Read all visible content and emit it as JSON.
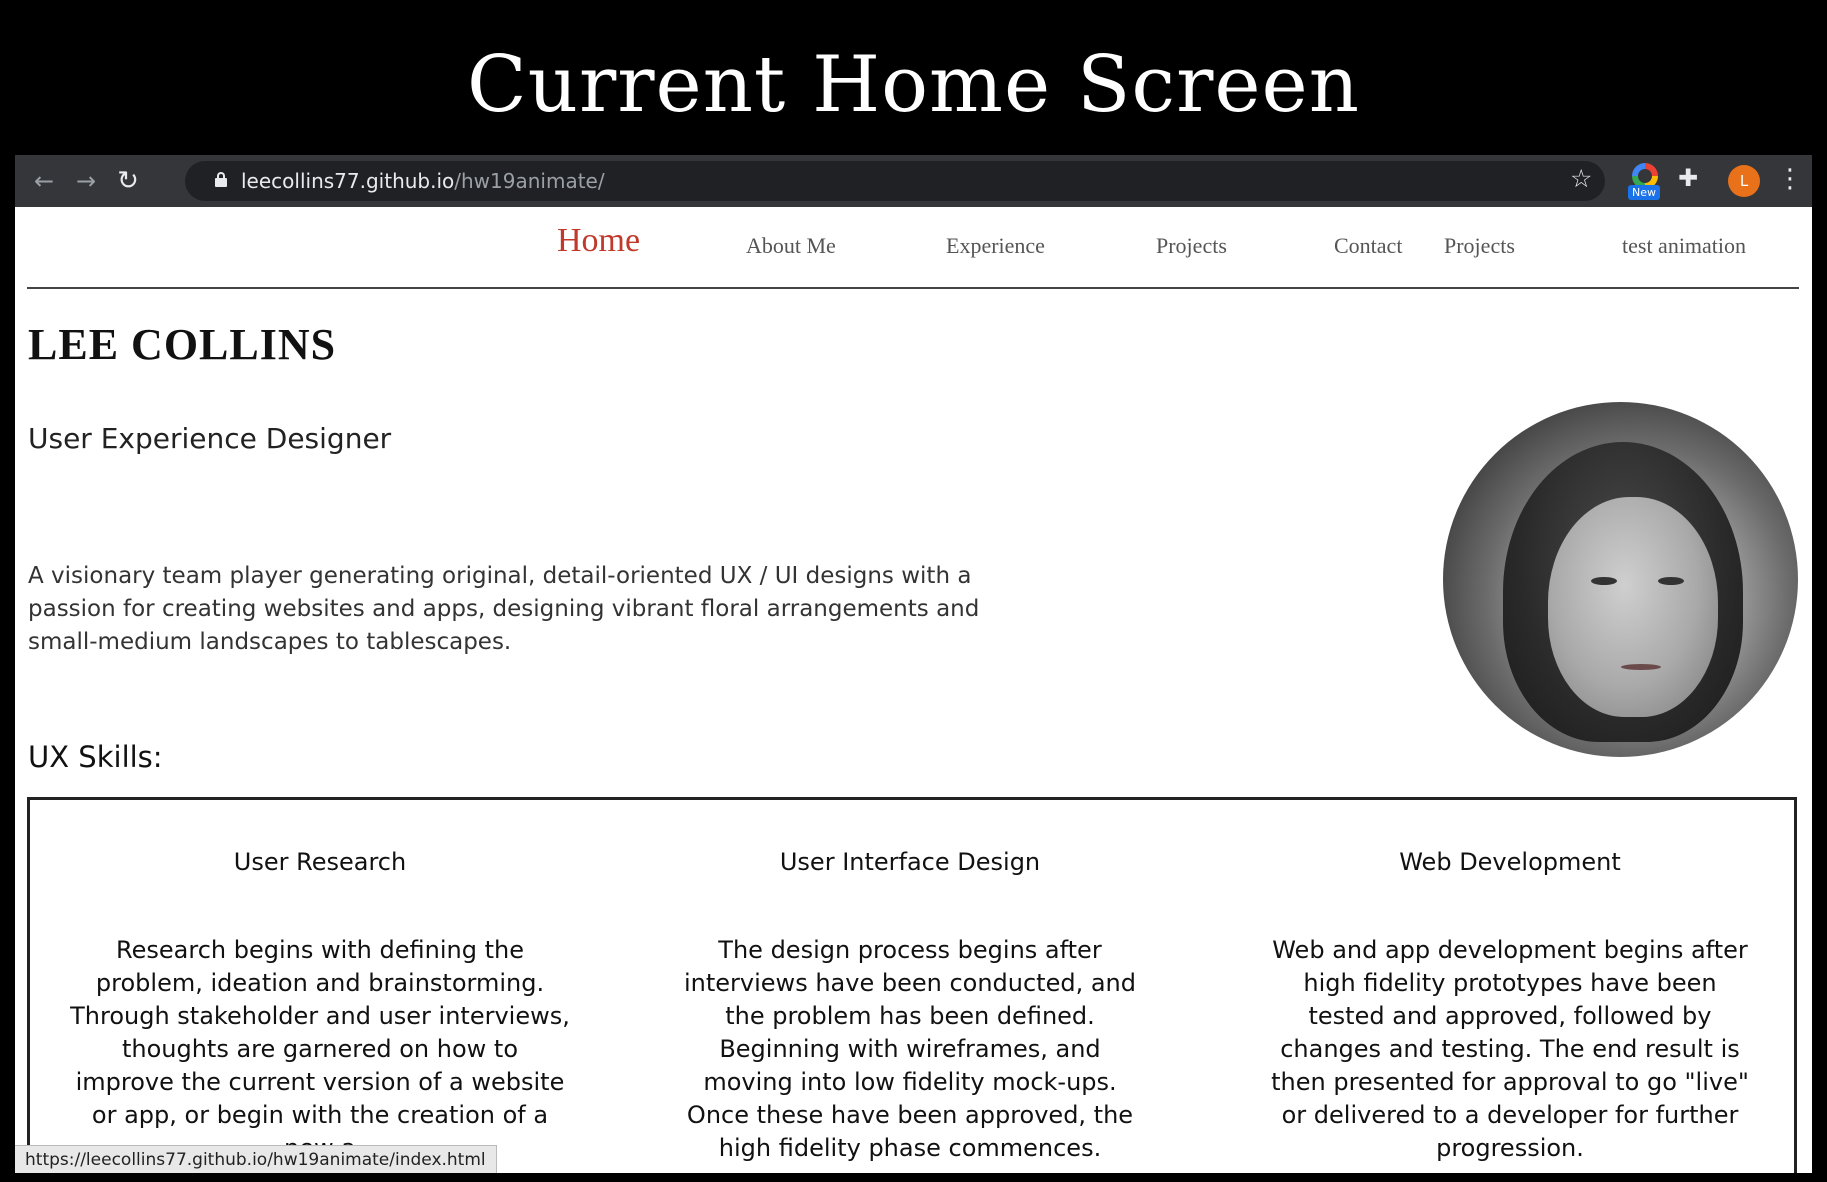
{
  "slide": {
    "title": "Current Home Screen"
  },
  "browser": {
    "url_host": "leecollins77.github.io",
    "url_path": "/hw19animate/",
    "extension_badge": "New",
    "profile_initial": "L",
    "status_url": "https://leecollins77.github.io/hw19animate/index.html"
  },
  "nav": {
    "items": [
      {
        "label": "Home",
        "active": true
      },
      {
        "label": "About Me"
      },
      {
        "label": "Experience"
      },
      {
        "label": "Projects"
      },
      {
        "label": "Contact"
      },
      {
        "label": "Projects"
      },
      {
        "label": "test animation"
      }
    ]
  },
  "hero": {
    "name": "LEE COLLINS",
    "role": "User Experience Designer",
    "intro": "A visionary team player generating original, detail-oriented UX / UI designs with a passion for creating websites and apps, designing vibrant floral arrangements and small-medium landscapes to tablescapes."
  },
  "skills": {
    "heading": "UX Skills:",
    "columns": [
      {
        "title": "User Research",
        "text": "Research begins with defining the problem, ideation and brainstorming. Through stakeholder and user interviews, thoughts are garnered on how to improve the current version of a website or app, or begin with the creation of a new a"
      },
      {
        "title": "User Interface Design",
        "text": "The design process begins after interviews have been conducted, and the problem has been defined. Beginning with wireframes, and moving into low fidelity mock-ups. Once these have been approved, the high fidelity phase commences."
      },
      {
        "title": "Web Development",
        "text": "Web and app development begins after high fidelity prototypes have been tested and approved, followed by changes and testing. The end result is then presented for approval to go \"live\" or delivered to a developer for further progression."
      }
    ]
  },
  "colors": {
    "nav_active": "#c0392b",
    "toolbar_bg": "#35363a",
    "profile_bg": "#e8711a"
  }
}
